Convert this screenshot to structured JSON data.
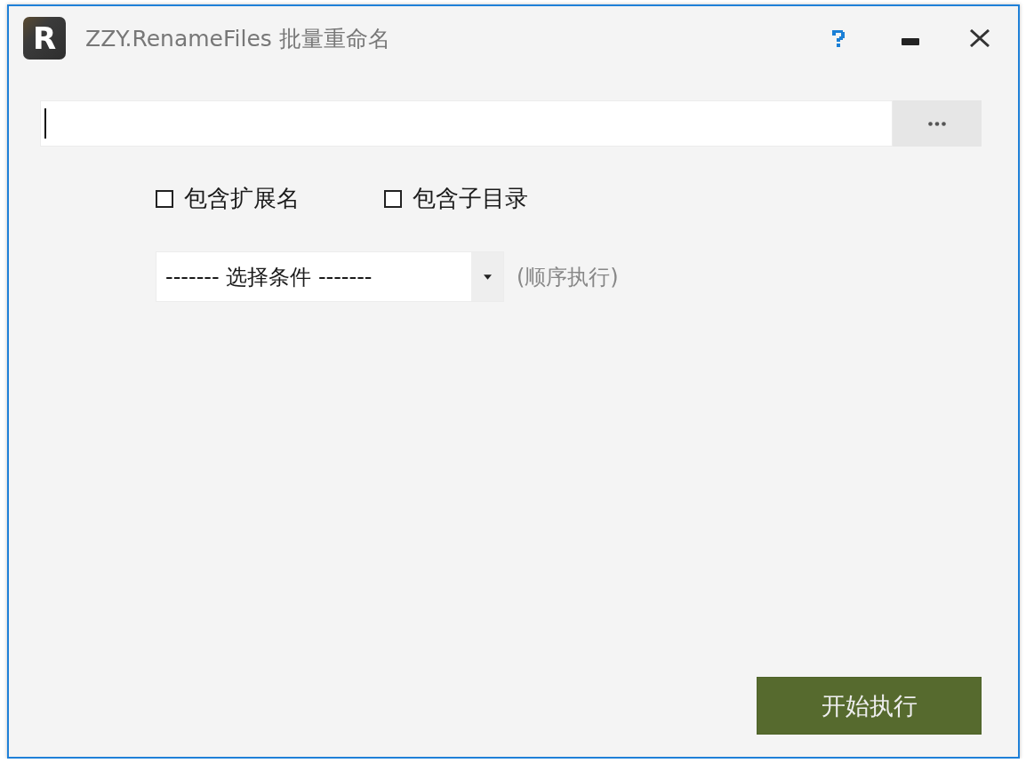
{
  "window": {
    "logo_letter": "R",
    "title": "ZZY.RenameFiles 批量重命名"
  },
  "path_field": {
    "focused": true
  },
  "options": [
    {
      "label": "包含扩展名",
      "checked": false
    },
    {
      "label": "包含子目录",
      "checked": false
    }
  ],
  "condition_select": {
    "value": "------- 选择条件 -------",
    "hint": "(顺序执行)"
  },
  "start_button": {
    "label": "开始执行"
  }
}
